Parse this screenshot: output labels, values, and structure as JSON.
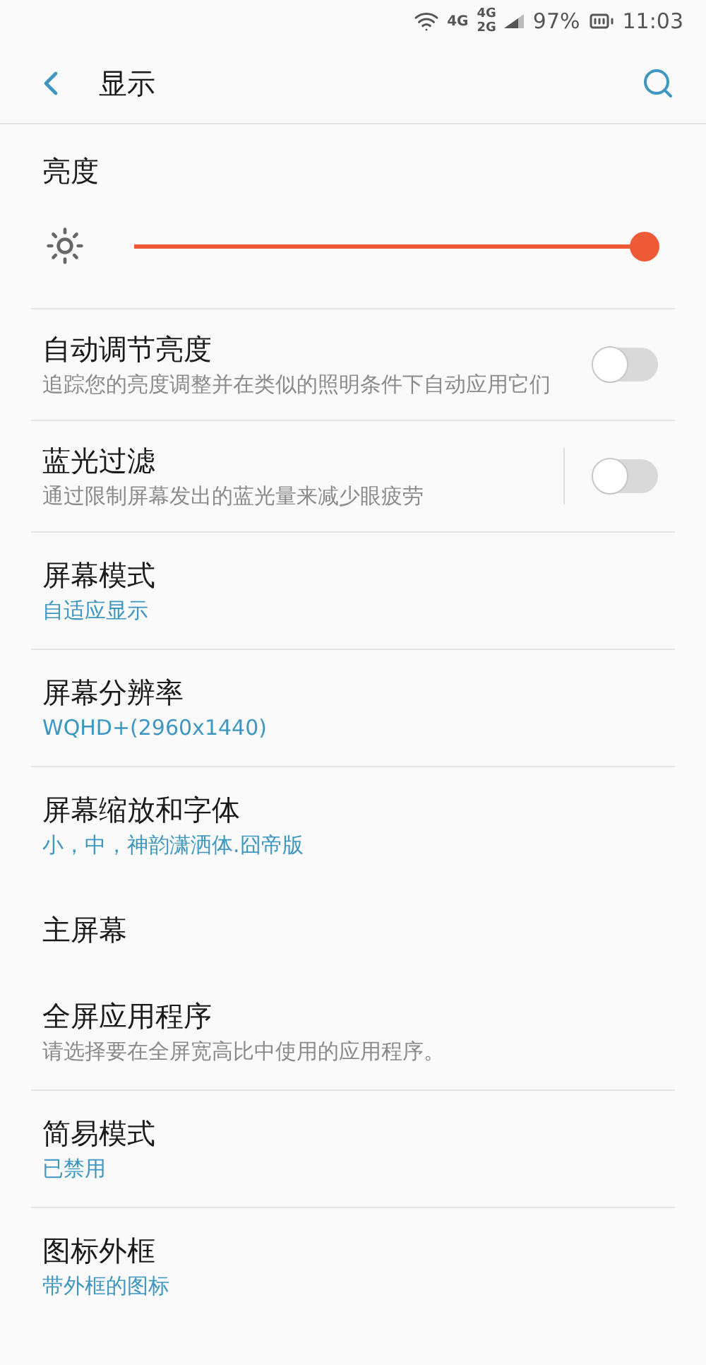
{
  "status_bar": {
    "network_1": "4G",
    "network_2_top": "4G",
    "network_2_bottom": "2G",
    "battery": "97%",
    "time": "11:03"
  },
  "header": {
    "title": "显示"
  },
  "items": [
    {
      "kind": "heading",
      "title": "亮度"
    },
    {
      "kind": "slider",
      "level": 1.0
    },
    {
      "kind": "switch",
      "title": "自动调节亮度",
      "description": "追踪您的亮度调整并在类似的照明条件下自动应用它们",
      "on": false,
      "separator": false
    },
    {
      "kind": "switch",
      "title": "蓝光过滤",
      "description": "通过限制屏幕发出的蓝光量来减少眼疲劳",
      "on": false,
      "separator": true
    },
    {
      "kind": "link",
      "title": "屏幕模式",
      "value": "自适应显示"
    },
    {
      "kind": "link",
      "title": "屏幕分辨率",
      "value": "WQHD+(2960x1440)"
    },
    {
      "kind": "link",
      "title": "屏幕缩放和字体",
      "value": "小，中，神韵潇洒体.囧帝版"
    },
    {
      "kind": "heading",
      "title": "主屏幕"
    },
    {
      "kind": "text",
      "title": "全屏应用程序",
      "description": "请选择要在全屏宽高比中使用的应用程序。"
    },
    {
      "kind": "link",
      "title": "简易模式",
      "value": "已禁用"
    },
    {
      "kind": "link",
      "title": "图标外框",
      "value": "带外框的图标"
    }
  ]
}
